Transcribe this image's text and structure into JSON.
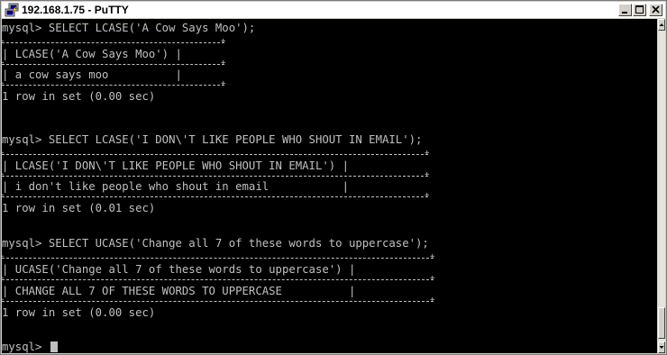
{
  "window": {
    "title": "192.168.1.75 - PuTTY",
    "buttons": {
      "minimize": "minimize",
      "maximize": "maximize",
      "close": "close"
    }
  },
  "terminal": {
    "lines": [
      "mysql> SELECT LCASE('A Cow Says Moo');",
      "| LCASE('A Cow Says Moo') |",
      "| a cow says moo          |",
      "1 row in set (0.00 sec)",
      "mysql> SELECT LCASE('I DON\\'T LIKE PEOPLE WHO SHOUT IN EMAIL');",
      "| LCASE('I DON\\'T LIKE PEOPLE WHO SHOUT IN EMAIL') |",
      "| i don't like people who shout in email           |",
      "1 row in set (0.01 sec)",
      "mysql> SELECT UCASE('Change all 7 of these words to uppercase');",
      "| UCASE('Change all 7 of these words to uppercase') |",
      "| CHANGE ALL 7 OF THESE WORDS TO UPPERCASE          |",
      "1 row in set (0.00 sec)",
      "mysql> "
    ]
  },
  "colors": {
    "terminal_bg": "#000000",
    "terminal_fg": "#c0c0c0",
    "chrome": "#d4d0c8"
  },
  "icons": [
    "putty-icon",
    "minimize-icon",
    "maximize-icon",
    "close-icon",
    "scroll-up-icon",
    "scroll-down-icon"
  ]
}
